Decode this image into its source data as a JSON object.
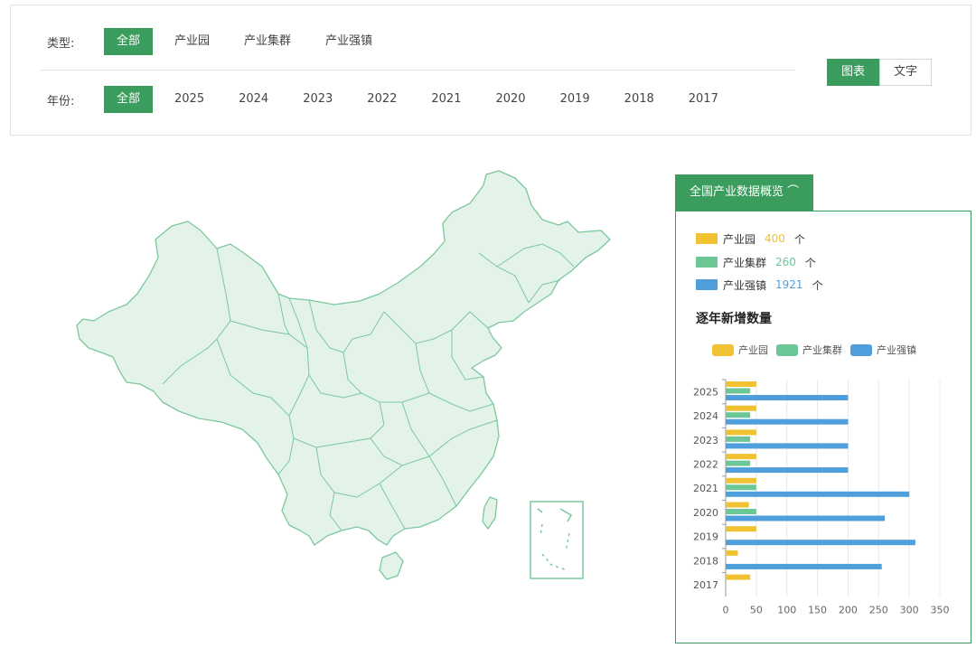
{
  "filters": {
    "type_label": "类型:",
    "type_options": [
      "全部",
      "产业园",
      "产业集群",
      "产业强镇"
    ],
    "type_selected": 0,
    "year_label": "年份:",
    "year_options": [
      "全部",
      "2025",
      "2024",
      "2023",
      "2022",
      "2021",
      "2020",
      "2019",
      "2018",
      "2017"
    ],
    "year_selected": 0
  },
  "view_toggle": {
    "chart_label": "图表",
    "text_label": "文字",
    "selected": "chart"
  },
  "overview": {
    "title": "全国产业数据概览 ⌒",
    "stats": [
      {
        "name": "产业园",
        "value": "400",
        "unit": "个",
        "color": "#f0c232"
      },
      {
        "name": "产业集群",
        "value": "260",
        "unit": "个",
        "color": "#6cc796"
      },
      {
        "name": "产业强镇",
        "value": "1921",
        "unit": "个",
        "color": "#4f9fdc"
      }
    ],
    "chart_title": "逐年新增数量"
  },
  "colors": {
    "accent": "#3a9c5d",
    "map_fill": "#e3f3ea",
    "map_stroke": "#7cc79c"
  },
  "chart_data": {
    "type": "bar",
    "orientation": "horizontal",
    "categories": [
      "2025",
      "2024",
      "2023",
      "2022",
      "2021",
      "2020",
      "2019",
      "2018",
      "2017"
    ],
    "series": [
      {
        "name": "产业园",
        "color": "#f0c232",
        "values": [
          50,
          50,
          50,
          50,
          50,
          38,
          50,
          20,
          40
        ]
      },
      {
        "name": "产业集群",
        "color": "#6cc796",
        "values": [
          40,
          40,
          40,
          40,
          50,
          50,
          0,
          0,
          0
        ]
      },
      {
        "name": "产业强镇",
        "color": "#4f9fdc",
        "values": [
          200,
          200,
          200,
          200,
          300,
          260,
          310,
          255,
          0
        ]
      }
    ],
    "x_ticks": [
      "0",
      "50",
      "100",
      "150",
      "200",
      "250",
      "300",
      "350"
    ],
    "xlim": [
      0,
      350
    ],
    "grid": true,
    "legend": "top"
  }
}
